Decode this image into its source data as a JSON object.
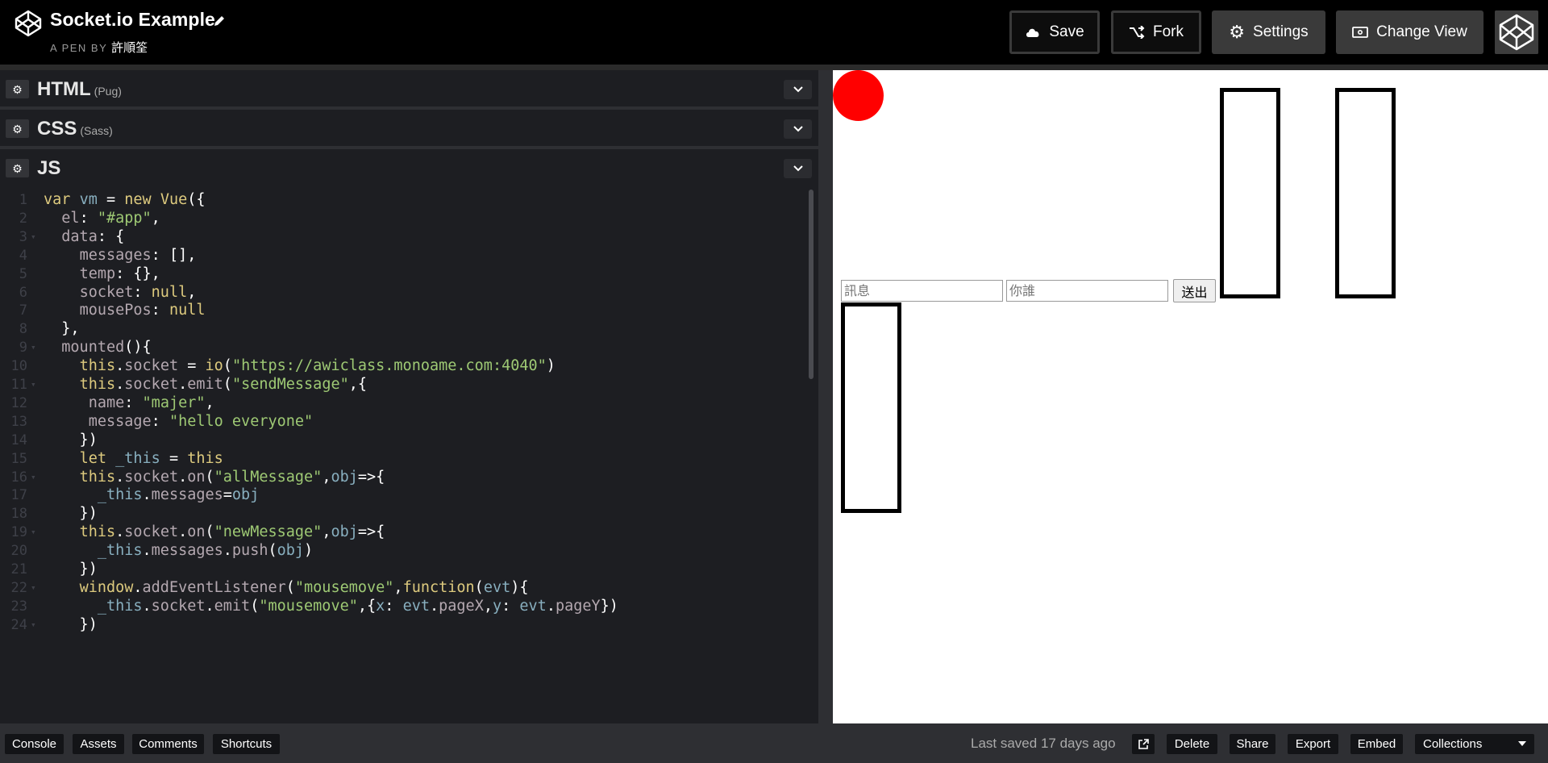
{
  "header": {
    "pen_title": "Socket.io Example",
    "pen_by": "A PEN BY",
    "author": "許順筌",
    "buttons": {
      "save": "Save",
      "fork": "Fork",
      "settings": "Settings",
      "change_view": "Change View"
    }
  },
  "editors": {
    "html": {
      "name": "HTML",
      "preprocessor": "(Pug)"
    },
    "css": {
      "name": "CSS",
      "preprocessor": "(Sass)"
    },
    "js": {
      "name": "JS"
    }
  },
  "code": {
    "line_numbers": [
      "1",
      "2",
      "3",
      "4",
      "5",
      "6",
      "7",
      "8",
      "9",
      "10",
      "11",
      "12",
      "13",
      "14",
      "15",
      "16",
      "17",
      "18",
      "19",
      "20",
      "21",
      "22",
      "23",
      "24"
    ],
    "lines": [
      "var vm = new Vue({",
      "  el: \"#app\",",
      "  data: {",
      "    messages: [],",
      "    temp: {},",
      "    socket: null,",
      "    mousePos: null",
      "  },",
      "  mounted(){",
      "    this.socket = io(\"https://awiclass.monoame.com:4040\")",
      "    this.socket.emit(\"sendMessage\",{",
      "     name: \"majer\",",
      "     message: \"hello everyone\"",
      "    })",
      "    let _this = this",
      "    this.socket.on(\"allMessage\",obj=>{",
      "      _this.messages=obj",
      "    })",
      "    this.socket.on(\"newMessage\",obj=>{",
      "      _this.messages.push(obj)",
      "    })",
      "    window.addEventListener(\"mousemove\",function(evt){",
      "      _this.socket.emit(\"mousemove\",{x: evt.pageX,y: evt.pageY})",
      "    })"
    ]
  },
  "preview": {
    "message_placeholder": "訊息",
    "name_placeholder": "你誰",
    "send_label": "送出"
  },
  "footer": {
    "console": "Console",
    "assets": "Assets",
    "comments": "Comments",
    "shortcuts": "Shortcuts",
    "last_saved": "Last saved 17 days ago",
    "delete": "Delete",
    "share": "Share",
    "export": "Export",
    "embed": "Embed",
    "collections": "Collections"
  }
}
